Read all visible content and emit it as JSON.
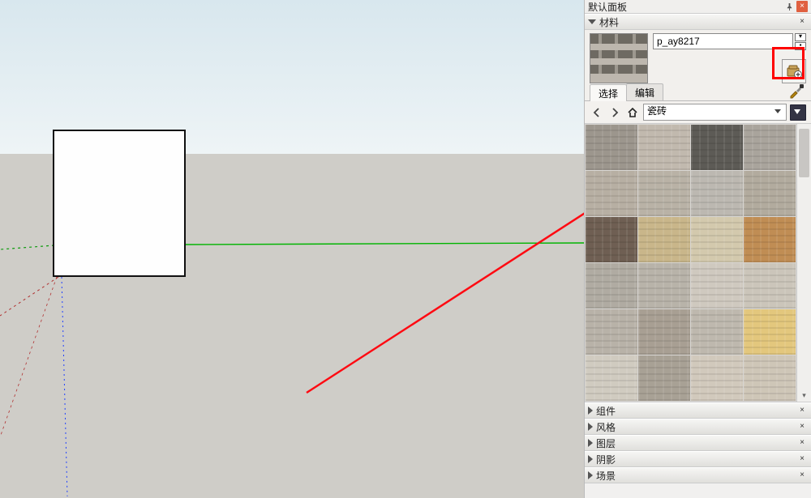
{
  "panel": {
    "main_title": "默认面板",
    "materials_title": "材料",
    "material_name": "p_ay8217",
    "tabs": {
      "select": "选择",
      "edit": "编辑"
    },
    "category_selected": "瓷砖",
    "collapsed": [
      "组件",
      "风格",
      "图层",
      "阴影",
      "场景"
    ]
  },
  "icons": {
    "pin": "pin-icon",
    "close": "close-icon",
    "close_small": "×",
    "back": "back-icon",
    "forward": "forward-icon",
    "home": "home-icon",
    "eyedrop": "eyedropper-icon",
    "create": "create-material-icon",
    "details": "details-icon"
  },
  "colors": {
    "highlight": "#ff0000",
    "arrow": "#ff0a12",
    "axis_green": "#00b400",
    "axis_blue": "#2040ff",
    "swatches": [
      "#9c968d",
      "#c1b9ae",
      "#5d5b56",
      "#a9a49c",
      "#b7afa3",
      "#b9b2a6",
      "#bcb8b1",
      "#b2ab9e",
      "#6f5f53",
      "#c9b68a",
      "#d3c9ad",
      "#c08d54",
      "#b0aba2",
      "#b8b3a9",
      "#cfc9bf",
      "#cbc5ba",
      "#b8b2a8",
      "#a89f93",
      "#beb8ae",
      "#e3c77d",
      "#d0cbc0",
      "#a8a195",
      "#d1c9bc",
      "#cec6b7"
    ]
  }
}
